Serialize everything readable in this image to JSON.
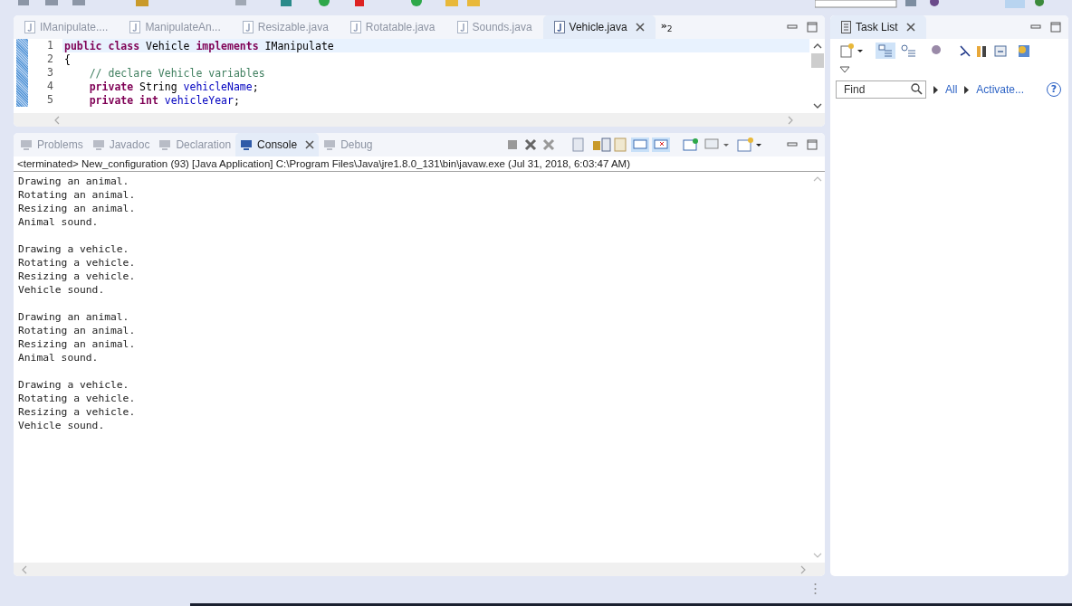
{
  "editor": {
    "tabs": [
      {
        "label": "IManipulate....",
        "selected": false
      },
      {
        "label": "ManipulateAn...",
        "selected": false
      },
      {
        "label": "Resizable.java",
        "selected": false
      },
      {
        "label": "Rotatable.java",
        "selected": false
      },
      {
        "label": "Sounds.java",
        "selected": false
      },
      {
        "label": "Vehicle.java",
        "selected": true
      }
    ],
    "overflow": {
      "symbol": "»",
      "count": "2"
    },
    "lines": [
      {
        "number": "1",
        "current": true,
        "tokens": [
          {
            "text": "public class ",
            "kind": "keyword"
          },
          {
            "text": "Vehicle ",
            "kind": "plain"
          },
          {
            "text": "implements ",
            "kind": "keyword"
          },
          {
            "text": "IManipulate",
            "kind": "plain"
          }
        ]
      },
      {
        "number": "2",
        "current": false,
        "tokens": [
          {
            "text": "{",
            "kind": "plain"
          }
        ]
      },
      {
        "number": "3",
        "current": false,
        "tokens": [
          {
            "text": "    // declare Vehicle variables",
            "kind": "comment"
          }
        ]
      },
      {
        "number": "4",
        "current": false,
        "tokens": [
          {
            "text": "    private ",
            "kind": "keyword"
          },
          {
            "text": "String ",
            "kind": "plain"
          },
          {
            "text": "vehicleName",
            "kind": "field"
          },
          {
            "text": ";",
            "kind": "plain"
          }
        ]
      },
      {
        "number": "5",
        "current": false,
        "tokens": [
          {
            "text": "    private int ",
            "kind": "keyword"
          },
          {
            "text": "vehicleYear",
            "kind": "field"
          },
          {
            "text": ";",
            "kind": "plain"
          }
        ]
      }
    ]
  },
  "console_view": {
    "tabs": [
      {
        "label": "Problems",
        "selected": false
      },
      {
        "label": "Javadoc",
        "selected": false
      },
      {
        "label": "Declaration",
        "selected": false
      },
      {
        "label": "Console",
        "selected": true
      },
      {
        "label": "Debug",
        "selected": false
      }
    ],
    "header": "<terminated> New_configuration (93) [Java Application] C:\\Program Files\\Java\\jre1.8.0_131\\bin\\javaw.exe (Jul 31, 2018, 6:03:47 AM)",
    "blocks": [
      [
        "Drawing an animal.",
        "Rotating an animal.",
        "Resizing an animal.",
        "Animal sound."
      ],
      [
        "Drawing a vehicle.",
        "Rotating a vehicle.",
        "Resizing a vehicle.",
        "Vehicle sound."
      ],
      [
        "Drawing an animal.",
        "Rotating an animal.",
        "Resizing an animal.",
        "Animal sound."
      ],
      [
        "Drawing a vehicle.",
        "Rotating a vehicle.",
        "Resizing a vehicle.",
        "Vehicle sound."
      ]
    ]
  },
  "task_list": {
    "title": "Task List",
    "find": {
      "placeholder": "Find"
    },
    "links": [
      "All",
      "Activate..."
    ],
    "help": "?"
  }
}
